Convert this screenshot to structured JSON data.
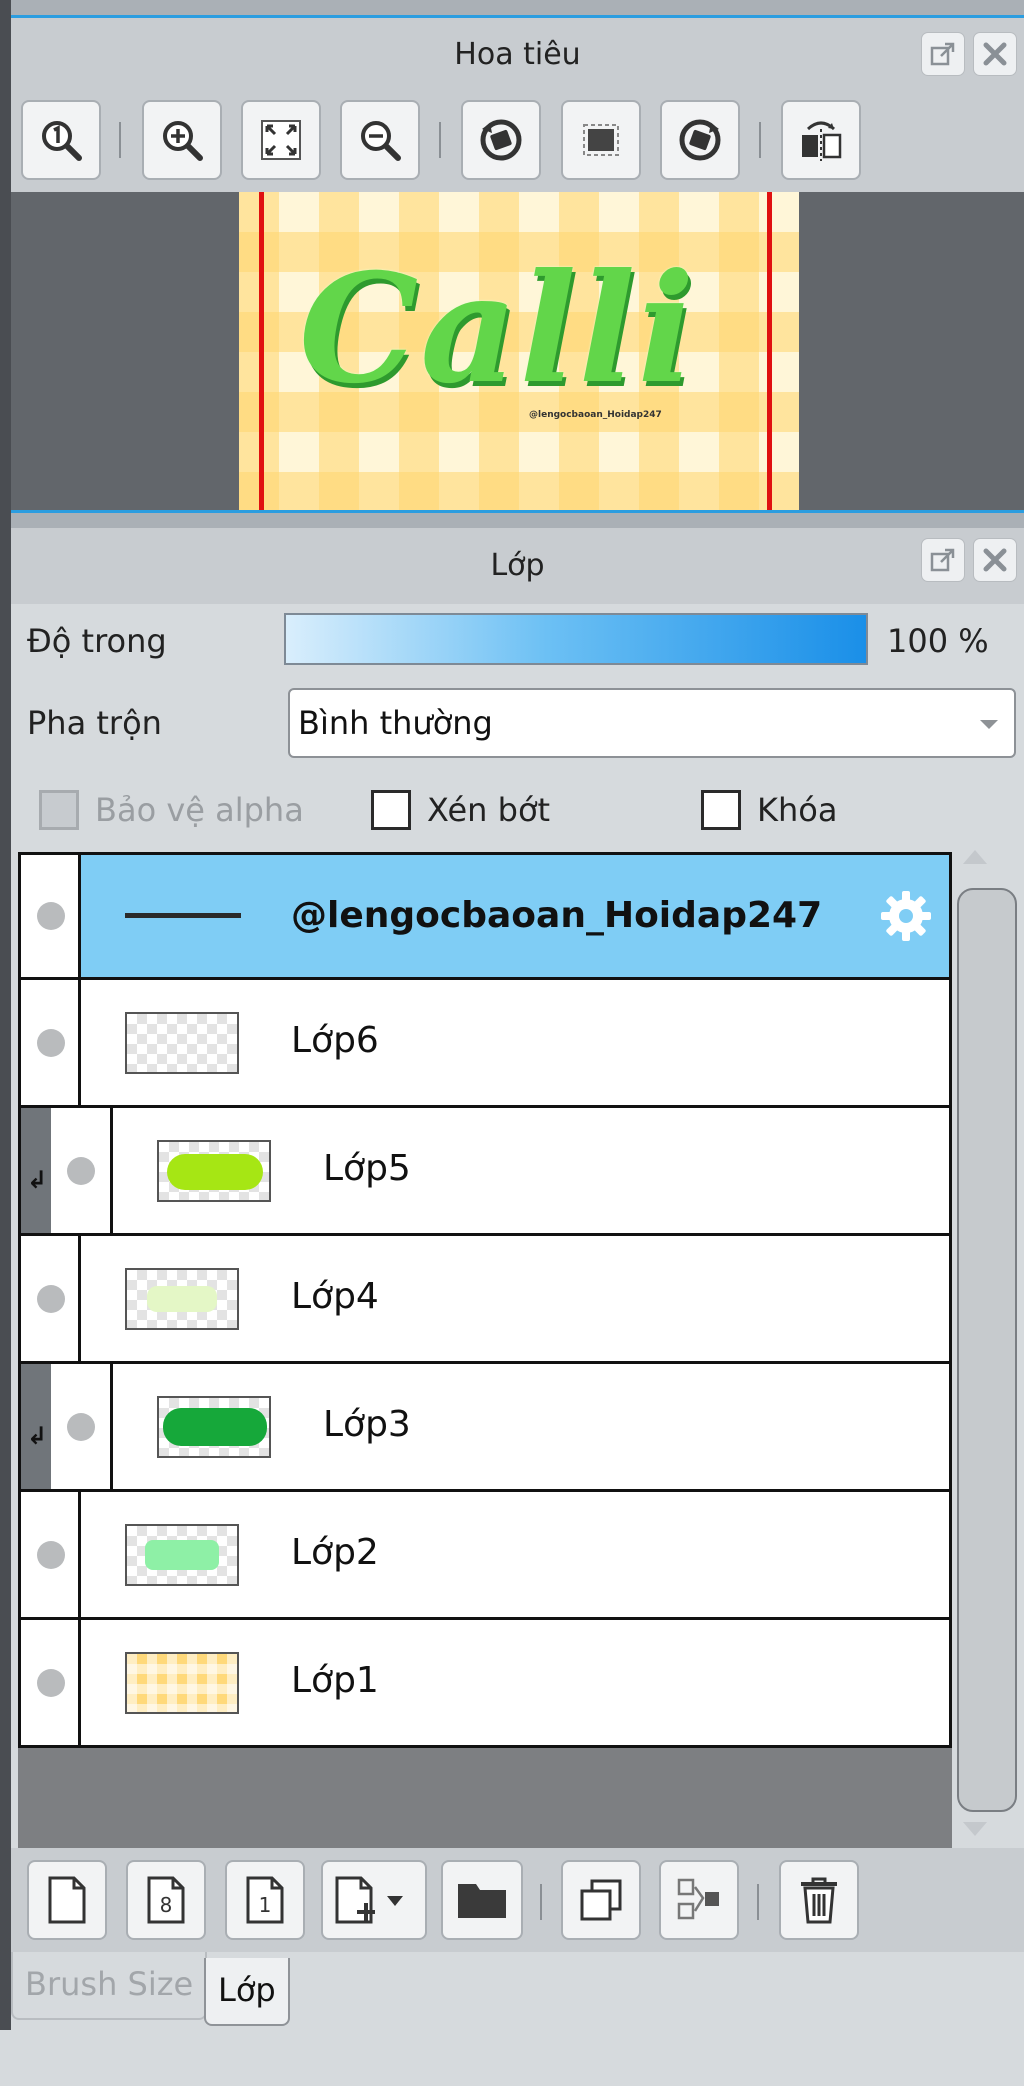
{
  "navigator": {
    "title": "Hoa tiêu",
    "header_buttons": [
      "float-icon",
      "close-icon"
    ],
    "toolbar": [
      "zoom-actual-icon",
      "zoom-in-icon",
      "fit-screen-icon",
      "zoom-out-icon",
      "rotate-left-icon",
      "reset-rotation-icon",
      "rotate-right-icon",
      "flip-horizontal-icon"
    ],
    "canvas_text": "Calli",
    "canvas_caption": "@lengocbaoan_Hoidap247"
  },
  "layers_panel": {
    "title": "Lớp",
    "opacity_label": "Độ trong",
    "opacity_value": "100 %",
    "opacity_fraction": 1.0,
    "blend_label": "Pha trộn",
    "blend_value": "Bình thường",
    "protect_alpha_label": "Bảo vệ alpha",
    "clip_label": "Xén bớt",
    "lock_label": "Khóa",
    "layers": [
      {
        "name": "@lengocbaoan_Hoidap247",
        "selected": true,
        "clipped": false,
        "type": "text"
      },
      {
        "name": "Lớp6",
        "selected": false,
        "clipped": false
      },
      {
        "name": "Lớp5",
        "selected": false,
        "clipped": true
      },
      {
        "name": "Lớp4",
        "selected": false,
        "clipped": false
      },
      {
        "name": "Lớp3",
        "selected": false,
        "clipped": true
      },
      {
        "name": "Lớp2",
        "selected": false,
        "clipped": false
      },
      {
        "name": "Lớp1",
        "selected": false,
        "clipped": false
      }
    ],
    "bottom_toolbar": [
      "new-layer-icon",
      "new-8bit-layer-icon",
      "new-1bit-layer-icon",
      "add-layer-menu-icon",
      "new-folder-icon",
      "duplicate-layer-icon",
      "merge-down-icon",
      "delete-layer-icon"
    ]
  },
  "tabs": [
    {
      "label": "Brush Size",
      "active": false
    },
    {
      "label": "Lớp",
      "active": true
    }
  ],
  "colors": {
    "selected_row": "#7fcdf5",
    "accent": "#2b9de0",
    "guide_line": "#e01010"
  }
}
